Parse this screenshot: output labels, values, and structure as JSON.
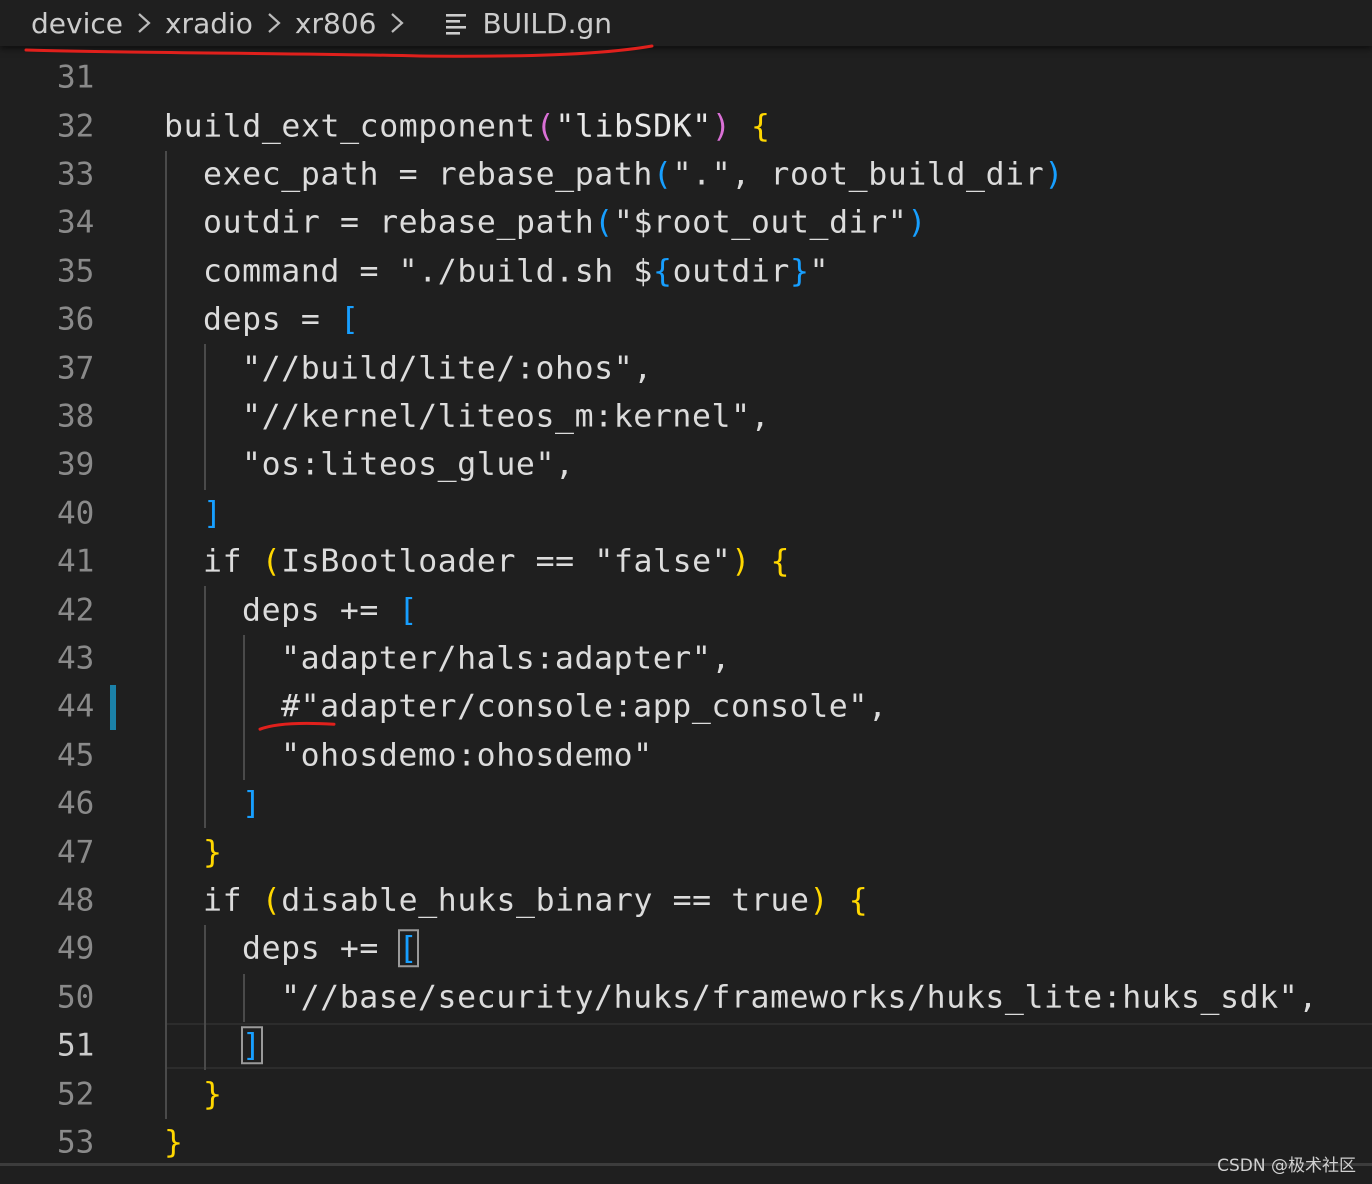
{
  "breadcrumb": {
    "items": [
      "device",
      "xradio",
      "xr806"
    ],
    "file_name": "BUILD.gn",
    "file_icon": "list-icon",
    "separator_icon": "chevron-right-icon"
  },
  "editor": {
    "current_line": "51",
    "lines": [
      {
        "num": "31",
        "indent": 0,
        "tokens": []
      },
      {
        "num": "32",
        "indent": 0,
        "tokens": [
          {
            "t": "build_ext_component",
            "c": "plain"
          },
          {
            "t": "(",
            "c": "paren"
          },
          {
            "t": "\"libSDK\"",
            "c": "str"
          },
          {
            "t": ")",
            "c": "paren"
          },
          {
            "t": " ",
            "c": "plain"
          },
          {
            "t": "{",
            "c": "brace"
          }
        ]
      },
      {
        "num": "33",
        "indent": 1,
        "tokens": [
          {
            "t": "exec_path = rebase_path",
            "c": "plain"
          },
          {
            "t": "(",
            "c": "bracket"
          },
          {
            "t": "\".\", root_build_dir",
            "c": "plain"
          },
          {
            "t": ")",
            "c": "bracket"
          }
        ]
      },
      {
        "num": "34",
        "indent": 1,
        "tokens": [
          {
            "t": "outdir = rebase_path",
            "c": "plain"
          },
          {
            "t": "(",
            "c": "bracket"
          },
          {
            "t": "\"$root_out_dir\"",
            "c": "plain"
          },
          {
            "t": ")",
            "c": "bracket"
          }
        ]
      },
      {
        "num": "35",
        "indent": 1,
        "tokens": [
          {
            "t": "command = \"./build.sh $",
            "c": "plain"
          },
          {
            "t": "{",
            "c": "bracket"
          },
          {
            "t": "outdir",
            "c": "plain"
          },
          {
            "t": "}",
            "c": "bracket"
          },
          {
            "t": "\"",
            "c": "plain"
          }
        ]
      },
      {
        "num": "36",
        "indent": 1,
        "tokens": [
          {
            "t": "deps = ",
            "c": "plain"
          },
          {
            "t": "[",
            "c": "bracket"
          }
        ]
      },
      {
        "num": "37",
        "indent": 2,
        "tokens": [
          {
            "t": "\"//build/lite/:ohos\",",
            "c": "plain"
          }
        ]
      },
      {
        "num": "38",
        "indent": 2,
        "tokens": [
          {
            "t": "\"//kernel/liteos_m:kernel\",",
            "c": "plain"
          }
        ]
      },
      {
        "num": "39",
        "indent": 2,
        "tokens": [
          {
            "t": "\"os:liteos_glue\",",
            "c": "plain"
          }
        ]
      },
      {
        "num": "40",
        "indent": 1,
        "tokens": [
          {
            "t": "]",
            "c": "bracket"
          }
        ]
      },
      {
        "num": "41",
        "indent": 1,
        "tokens": [
          {
            "t": "if ",
            "c": "plain"
          },
          {
            "t": "(",
            "c": "brace"
          },
          {
            "t": "IsBootloader == \"false\"",
            "c": "plain"
          },
          {
            "t": ")",
            "c": "brace"
          },
          {
            "t": " ",
            "c": "plain"
          },
          {
            "t": "{",
            "c": "brace"
          }
        ]
      },
      {
        "num": "42",
        "indent": 2,
        "tokens": [
          {
            "t": "deps += ",
            "c": "plain"
          },
          {
            "t": "[",
            "c": "bracket"
          }
        ]
      },
      {
        "num": "43",
        "indent": 3,
        "tokens": [
          {
            "t": "\"adapter/hals:adapter\",",
            "c": "plain"
          }
        ]
      },
      {
        "num": "44",
        "indent": 3,
        "tokens": [
          {
            "t": "#\"adapter/console:app_console\",",
            "c": "plain"
          }
        ]
      },
      {
        "num": "45",
        "indent": 3,
        "tokens": [
          {
            "t": "\"ohosdemo:ohosdemo\"",
            "c": "plain"
          }
        ]
      },
      {
        "num": "46",
        "indent": 2,
        "tokens": [
          {
            "t": "]",
            "c": "bracket"
          }
        ]
      },
      {
        "num": "47",
        "indent": 1,
        "tokens": [
          {
            "t": "}",
            "c": "brace"
          }
        ]
      },
      {
        "num": "48",
        "indent": 1,
        "tokens": [
          {
            "t": "if ",
            "c": "plain"
          },
          {
            "t": "(",
            "c": "brace"
          },
          {
            "t": "disable_huks_binary == true",
            "c": "plain"
          },
          {
            "t": ")",
            "c": "brace"
          },
          {
            "t": " ",
            "c": "plain"
          },
          {
            "t": "{",
            "c": "brace"
          }
        ]
      },
      {
        "num": "49",
        "indent": 2,
        "tokens": [
          {
            "t": "deps += ",
            "c": "plain"
          },
          {
            "t": "[",
            "c": "bracket",
            "box": true
          }
        ]
      },
      {
        "num": "50",
        "indent": 3,
        "tokens": [
          {
            "t": "\"//base/security/huks/frameworks/huks_lite:huks_sdk\",",
            "c": "plain"
          }
        ]
      },
      {
        "num": "51",
        "indent": 2,
        "tokens": [
          {
            "t": "]",
            "c": "bracket",
            "box": true
          }
        ]
      },
      {
        "num": "52",
        "indent": 1,
        "tokens": [
          {
            "t": "}",
            "c": "brace"
          }
        ]
      },
      {
        "num": "53",
        "indent": 0,
        "tokens": [
          {
            "t": "}",
            "c": "brace"
          }
        ]
      }
    ]
  },
  "colors": {
    "background": "#1f1f1f",
    "annotation_red": "#e0201c",
    "modified_gutter": "#1b81a8",
    "bracket_blue": "#179fff",
    "brace_gold": "#ffd700",
    "paren_purple": "#da70d6"
  },
  "watermark": "CSDN @极术社区"
}
